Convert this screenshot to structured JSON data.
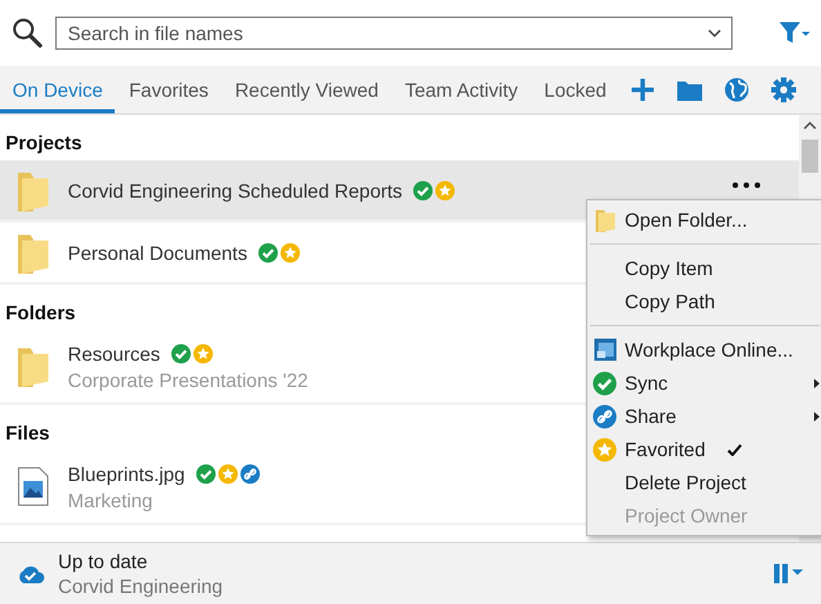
{
  "search": {
    "placeholder": "Search in file names"
  },
  "tabs": [
    {
      "label": "On Device",
      "selected": true
    },
    {
      "label": "Favorites",
      "selected": false
    },
    {
      "label": "Recently Viewed",
      "selected": false
    },
    {
      "label": "Team Activity",
      "selected": false
    },
    {
      "label": "Locked",
      "selected": false
    }
  ],
  "sections": [
    {
      "title": "Projects",
      "items": [
        {
          "kind": "folder",
          "name": "Corvid Engineering Scheduled Reports",
          "selected": true,
          "synced": true,
          "favorite": true,
          "shared": false
        },
        {
          "kind": "folder",
          "name": "Personal Documents",
          "selected": false,
          "synced": true,
          "favorite": true,
          "shared": false
        }
      ]
    },
    {
      "title": "Folders",
      "items": [
        {
          "kind": "folder",
          "name": "Resources",
          "subtitle": "Corporate Presentations '22",
          "selected": false,
          "synced": true,
          "favorite": true,
          "shared": false
        }
      ]
    },
    {
      "title": "Files",
      "items": [
        {
          "kind": "image",
          "name": "Blueprints.jpg",
          "subtitle": "Marketing",
          "selected": false,
          "synced": true,
          "favorite": true,
          "shared": true
        }
      ]
    }
  ],
  "context_menu": [
    {
      "kind": "folder",
      "label": "Open Folder...",
      "submenu": false,
      "checked": false,
      "disabled": false
    },
    {
      "kind": "separator"
    },
    {
      "kind": "plain",
      "label": "Copy Item",
      "submenu": false,
      "checked": false,
      "disabled": false
    },
    {
      "kind": "plain",
      "label": "Copy Path",
      "submenu": false,
      "checked": false,
      "disabled": false
    },
    {
      "kind": "separator"
    },
    {
      "kind": "web",
      "label": "Workplace Online...",
      "submenu": false,
      "checked": false,
      "disabled": false
    },
    {
      "kind": "sync",
      "label": "Sync",
      "submenu": true,
      "checked": false,
      "disabled": false
    },
    {
      "kind": "share",
      "label": "Share",
      "submenu": true,
      "checked": false,
      "disabled": false
    },
    {
      "kind": "favorite",
      "label": "Favorited",
      "submenu": false,
      "checked": true,
      "disabled": false
    },
    {
      "kind": "plain",
      "label": "Delete Project",
      "submenu": false,
      "checked": false,
      "disabled": false
    },
    {
      "kind": "plain",
      "label": "Project Owner",
      "submenu": false,
      "checked": false,
      "disabled": true
    }
  ],
  "status_bar": {
    "title": "Up to date",
    "subtitle": "Corvid Engineering"
  }
}
